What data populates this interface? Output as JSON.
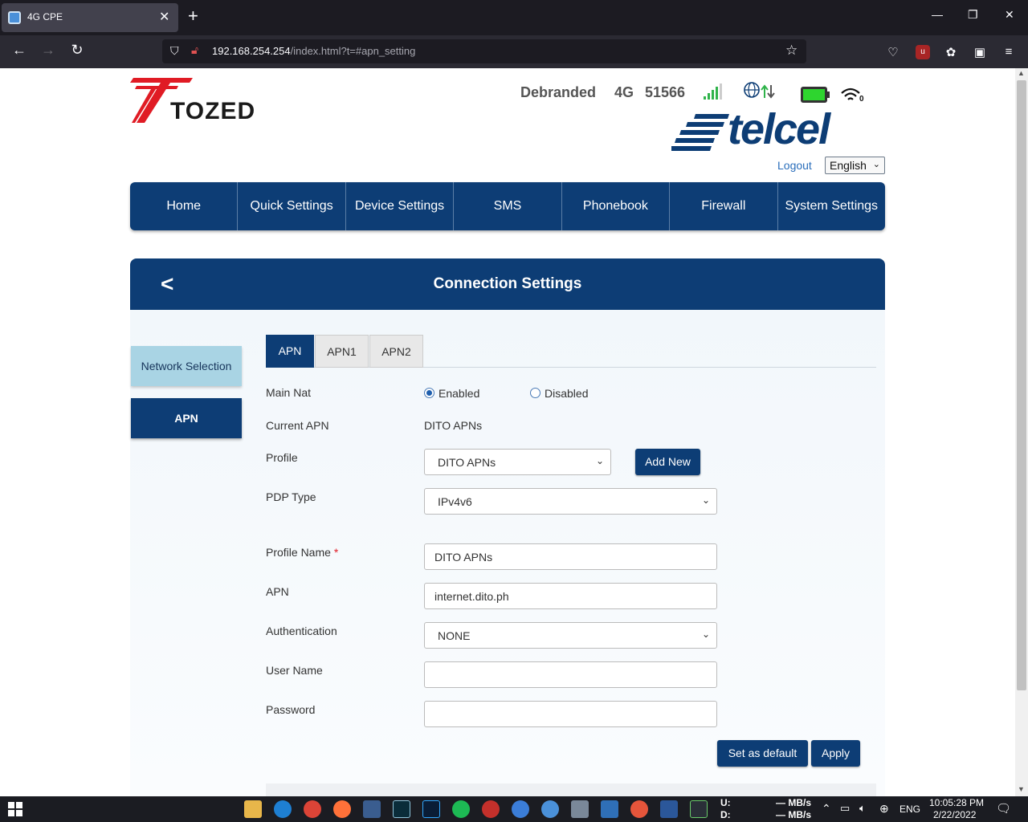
{
  "browser": {
    "tab_title": "4G CPE",
    "url_host": "192.168.254.254",
    "url_path": "/index.html?t=#apn_setting"
  },
  "header": {
    "logo_text": "TOZED",
    "brand_status": "Debranded",
    "network_type": "4G",
    "operator_code": "51566",
    "wifi_clients": "0",
    "carrier_logo": "telcel",
    "logout_label": "Logout",
    "language": "English"
  },
  "menu": [
    {
      "label": "Home"
    },
    {
      "label": "Quick Settings"
    },
    {
      "label": "Device Settings"
    },
    {
      "label": "SMS"
    },
    {
      "label": "Phonebook"
    },
    {
      "label": "Firewall"
    },
    {
      "label": "System Settings"
    }
  ],
  "section": {
    "title": "Connection Settings"
  },
  "side_menu": {
    "network_selection": "Network Selection",
    "apn": "APN"
  },
  "tabs": [
    "APN",
    "APN1",
    "APN2"
  ],
  "form": {
    "main_nat_label": "Main Nat",
    "enabled_label": "Enabled",
    "disabled_label": "Disabled",
    "main_nat_value": "Enabled",
    "current_apn_label": "Current APN",
    "current_apn_value": "DITO APNs",
    "profile_label": "Profile",
    "profile_value": "DITO APNs",
    "add_new_label": "Add New",
    "pdp_type_label": "PDP Type",
    "pdp_type_value": "IPv4v6",
    "profile_name_label": "Profile Name",
    "required_mark": "*",
    "profile_name_value": "DITO APNs",
    "apn_label": "APN",
    "apn_value": "internet.dito.ph",
    "authentication_label": "Authentication",
    "authentication_value": "NONE",
    "username_label": "User Name",
    "username_value": "",
    "password_label": "Password",
    "password_value": "",
    "set_default_label": "Set as default",
    "apply_label": "Apply"
  },
  "taskbar": {
    "net_up": "U:",
    "net_down": "D:",
    "up_rate": "— MB/s",
    "down_rate": "— MB/s",
    "lang": "ENG",
    "time": "10:05:28 PM",
    "date": "2/22/2022"
  },
  "colors": {
    "primary": "#0d3d75",
    "side_selected": "#a9d4e4",
    "link": "#2a6ebb"
  }
}
